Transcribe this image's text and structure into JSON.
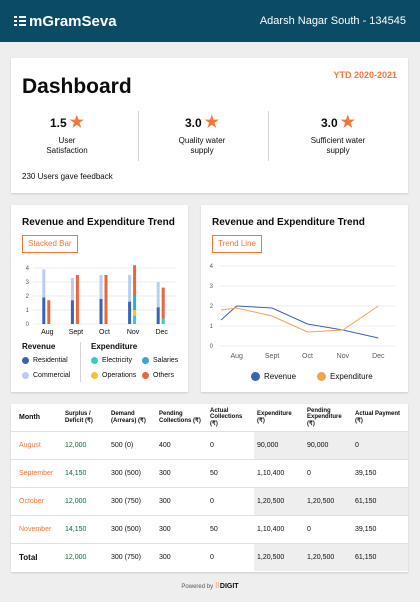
{
  "app": {
    "name": "mGramSeva",
    "location": "Adarsh Nagar South - 134545"
  },
  "dashboard": {
    "title": "Dashboard",
    "period": "YTD 2020-2021",
    "metrics": [
      {
        "value": "1.5",
        "label_line1": "User",
        "label_line2": "Satisfaction"
      },
      {
        "value": "3.0",
        "label_line1": "Quality water",
        "label_line2": "supply"
      },
      {
        "value": "3.0",
        "label_line1": "Sufficient water",
        "label_line2": "supply"
      }
    ],
    "feedback": "230 Users gave feedback"
  },
  "colors": {
    "brand": "#0b4b66",
    "accent": "#f47738",
    "residential": "#3a62b8",
    "commercial": "#b9cdf1",
    "electricity": "#38c9c2",
    "operations": "#f4c235",
    "salaries": "#3aa6d6",
    "others": "#e8663b"
  },
  "chart1": {
    "title": "Revenue and Expenditure Trend",
    "button": "Stacked Bar",
    "legend": {
      "revenue_title": "Revenue",
      "expenditure_title": "Expenditure",
      "residential": "Residential",
      "commercial": "Commercial",
      "electricity": "Electricity",
      "operations": "Operations",
      "salaries": "Salaries",
      "others": "Others"
    }
  },
  "chart2": {
    "title": "Revenue and Expenditure Trend",
    "button": "Trend Line",
    "legend": {
      "revenue": "Revenue",
      "expenditure": "Expenditure"
    }
  },
  "chart_data": [
    {
      "type": "bar",
      "stacked": true,
      "categories": [
        "Aug",
        "Sept",
        "Oct",
        "Nov",
        "Dec"
      ],
      "ylim": [
        0,
        4
      ],
      "yticks": [
        "0",
        "1",
        "2",
        "3",
        "4"
      ],
      "series": [
        {
          "name": "Residential",
          "group": "Revenue",
          "values": [
            1.9,
            1.7,
            1.8,
            1.6,
            1.2
          ]
        },
        {
          "name": "Commercial",
          "group": "Revenue",
          "values": [
            2.0,
            1.6,
            1.7,
            1.9,
            1.8
          ]
        },
        {
          "name": "Electricity",
          "group": "Expenditure",
          "values": [
            0.0,
            0.0,
            0.0,
            0.6,
            0.4
          ]
        },
        {
          "name": "Operations",
          "group": "Expenditure",
          "values": [
            0.0,
            0.0,
            0.0,
            0.4,
            0.0
          ]
        },
        {
          "name": "Salaries",
          "group": "Expenditure",
          "values": [
            0.0,
            0.0,
            0.0,
            1.0,
            0.0
          ]
        },
        {
          "name": "Others",
          "group": "Expenditure",
          "values": [
            1.7,
            3.5,
            3.5,
            2.2,
            2.2
          ]
        }
      ],
      "title": "Revenue and Expenditure Trend"
    },
    {
      "type": "line",
      "categories": [
        "Aug",
        "Sept",
        "Oct",
        "Nov",
        "Dec"
      ],
      "ylim": [
        0,
        4
      ],
      "yticks": [
        "0",
        "1",
        "2",
        "3",
        "4"
      ],
      "series": [
        {
          "name": "Revenue",
          "values": [
            2.0,
            1.9,
            1.1,
            0.8,
            0.4
          ]
        },
        {
          "name": "Expenditure",
          "values": [
            1.9,
            1.5,
            0.7,
            0.8,
            2.0
          ]
        }
      ],
      "title": "Revenue and Expenditure Trend"
    }
  ],
  "table": {
    "headers": [
      "Month",
      "Surplus / Deficit (₹)",
      "Demand (Arrears) (₹)",
      "Pending Collections (₹)",
      "Actual Collections (₹)",
      "Expenditure (₹)",
      "Pending Expenditure (₹)",
      "Actual Payment (₹)"
    ],
    "rows": [
      [
        "August",
        "12,000",
        "500 (0)",
        "400",
        "0",
        "90,000",
        "90,000",
        "0"
      ],
      [
        "September",
        "14,150",
        "300 (500)",
        "300",
        "50",
        "1,10,400",
        "0",
        "39,150"
      ],
      [
        "October",
        "12,000",
        "300 (750)",
        "300",
        "0",
        "1,20,500",
        "1,20,500",
        "61,150"
      ],
      [
        "November",
        "14,150",
        "300 (500)",
        "300",
        "50",
        "1,10,400",
        "0",
        "39,150"
      ]
    ],
    "total": [
      "Total",
      "12,000",
      "300 (750)",
      "300",
      "0",
      "1,20,500",
      "1,20,500",
      "61,150"
    ]
  },
  "footer": {
    "powered_by": "Powered by",
    "brand": "DIGIT"
  }
}
